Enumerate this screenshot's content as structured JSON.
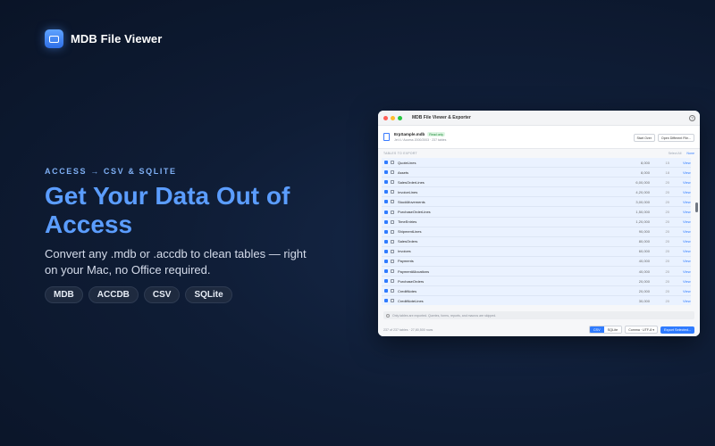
{
  "brand": {
    "name": "MDB File Viewer"
  },
  "hero": {
    "eyebrow": "ACCESS → CSV & SQLITE",
    "headline": "Get Your Data Out of Access",
    "subtitle": "Convert any .mdb or .accdb to clean tables — right on your Mac, no Office required.",
    "chips": [
      "MDB",
      "ACCDB",
      "CSV",
      "SQLite"
    ]
  },
  "window": {
    "title": "MDB File Viewer & Exporter",
    "file": {
      "name": "ErpSample.mdb",
      "badge": "Read only",
      "sub": "Jet 4 / Access 2000/2003 · 237 tables"
    },
    "actions": {
      "start_over": "Start Over",
      "open_different": "Open Different File..."
    },
    "section": {
      "title": "TABLES TO EXPORT",
      "select_all": "Select All",
      "none": "None"
    },
    "rows": [
      {
        "name": "QuoteLines",
        "count": "8,000",
        "cols": "15",
        "action": "View"
      },
      {
        "name": "Assets",
        "count": "8,000",
        "cols": "18",
        "action": "View"
      },
      {
        "name": "SalesOrderLines",
        "count": "6,00,000",
        "cols": "20",
        "action": "View"
      },
      {
        "name": "InvoiceLines",
        "count": "4,20,000",
        "cols": "20",
        "action": "View"
      },
      {
        "name": "StockMovements",
        "count": "3,00,000",
        "cols": "20",
        "action": "View"
      },
      {
        "name": "PurchaseOrderLines",
        "count": "1,50,000",
        "cols": "20",
        "action": "View"
      },
      {
        "name": "TimeEntries",
        "count": "1,20,000",
        "cols": "20",
        "action": "View"
      },
      {
        "name": "ShipmentLines",
        "count": "90,000",
        "cols": "20",
        "action": "View"
      },
      {
        "name": "SalesOrders",
        "count": "80,000",
        "cols": "20",
        "action": "View"
      },
      {
        "name": "Invoices",
        "count": "60,000",
        "cols": "20",
        "action": "View"
      },
      {
        "name": "Payments",
        "count": "40,000",
        "cols": "20",
        "action": "View"
      },
      {
        "name": "PaymentAllocations",
        "count": "40,000",
        "cols": "20",
        "action": "View"
      },
      {
        "name": "PurchaseOrders",
        "count": "20,000",
        "cols": "20",
        "action": "View"
      },
      {
        "name": "CreditNotes",
        "count": "20,000",
        "cols": "20",
        "action": "View"
      },
      {
        "name": "CreditNoteLines",
        "count": "30,000",
        "cols": "20",
        "action": "View"
      }
    ],
    "notice": "Only tables are exported. Queries, forms, reports, and macros are skipped.",
    "footer": {
      "summary": "237 of 237 tables · 27,80,500 rows",
      "formats": [
        "CSV",
        "SQLite"
      ],
      "delimiter": "Comma · UTF-8",
      "export": "Export Selected..."
    }
  },
  "colors": {
    "accent": "#2f7bff",
    "headline": "#5b9dff",
    "background": "#0f1d36"
  }
}
